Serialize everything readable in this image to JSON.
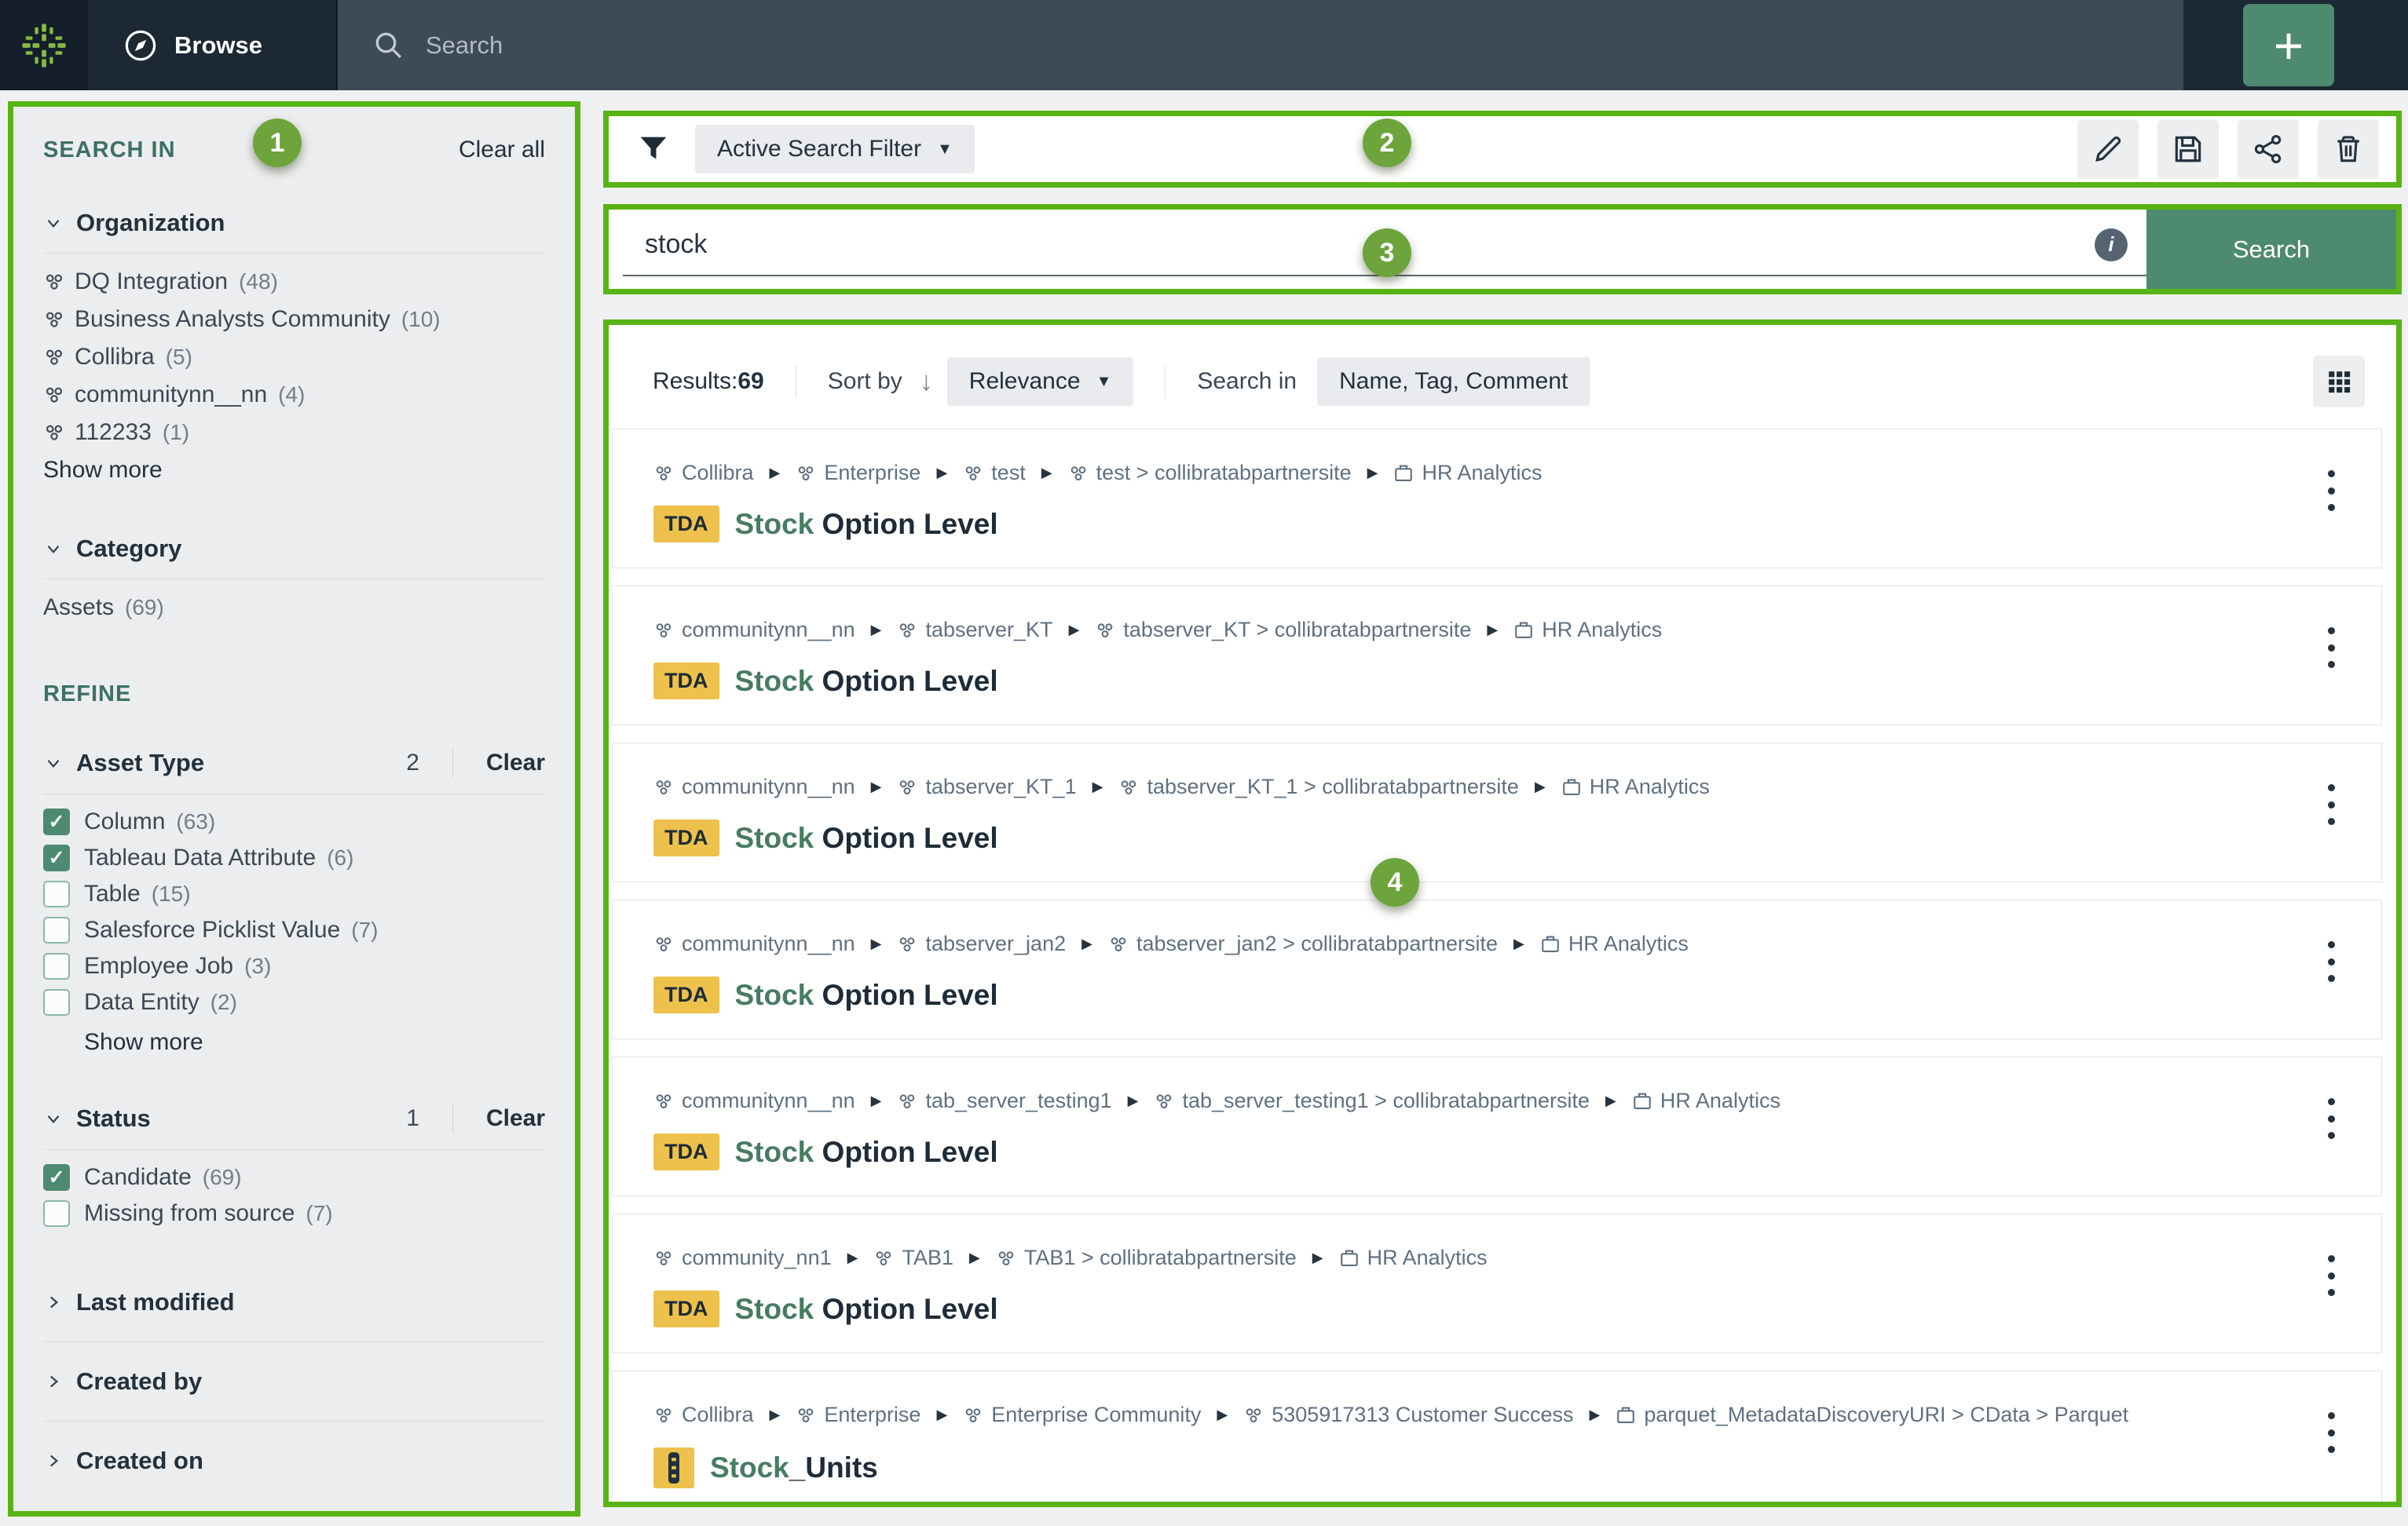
{
  "topbar": {
    "browse_label": "Browse",
    "search_placeholder": "Search",
    "plus_label": "+"
  },
  "annotations": {
    "border_color": "#58b314",
    "badge_color": "#6da43c",
    "badge1": "1",
    "badge2": "2",
    "badge3": "3",
    "badge4": "4"
  },
  "sidebar": {
    "search_in_label": "SEARCH IN",
    "clear_all_label": "Clear all",
    "organization": {
      "title": "Organization",
      "items": [
        {
          "label": "DQ Integration",
          "count": "(48)"
        },
        {
          "label": "Business Analysts Community",
          "count": "(10)"
        },
        {
          "label": "Collibra",
          "count": "(5)"
        },
        {
          "label": "communitynn__nn",
          "count": "(4)"
        },
        {
          "label": "112233",
          "count": "(1)"
        }
      ],
      "show_more": "Show more"
    },
    "category": {
      "title": "Category",
      "items": [
        {
          "label": "Assets",
          "count": "(69)"
        }
      ]
    },
    "refine_label": "REFINE",
    "asset_type": {
      "title": "Asset Type",
      "selected_count": "2",
      "clear_label": "Clear",
      "options": [
        {
          "label": "Column",
          "count": "(63)",
          "checked": true
        },
        {
          "label": "Tableau Data Attribute",
          "count": "(6)",
          "checked": true
        },
        {
          "label": "Table",
          "count": "(15)",
          "checked": false
        },
        {
          "label": "Salesforce Picklist Value",
          "count": "(7)",
          "checked": false
        },
        {
          "label": "Employee Job",
          "count": "(3)",
          "checked": false
        },
        {
          "label": "Data Entity",
          "count": "(2)",
          "checked": false
        }
      ],
      "show_more": "Show more"
    },
    "status": {
      "title": "Status",
      "selected_count": "1",
      "clear_label": "Clear",
      "options": [
        {
          "label": "Candidate",
          "count": "(69)",
          "checked": true
        },
        {
          "label": "Missing from source",
          "count": "(7)",
          "checked": false
        }
      ]
    },
    "collapsed": [
      {
        "title": "Last modified"
      },
      {
        "title": "Created by"
      },
      {
        "title": "Created on"
      }
    ]
  },
  "filterbar": {
    "active_filter_label": "Active Search Filter"
  },
  "searchbar": {
    "query": "stock",
    "button_label": "Search"
  },
  "results": {
    "results_label": "Results:",
    "count": "69",
    "sort_by_label": "Sort by",
    "sort_value": "Relevance",
    "search_in_label": "Search in",
    "search_fields": "Name, Tag, Comment",
    "items": [
      {
        "breadcrumbs": [
          {
            "icon": "community",
            "label": "Collibra"
          },
          {
            "icon": "community",
            "label": "Enterprise"
          },
          {
            "icon": "community",
            "label": "test"
          },
          {
            "icon": "community",
            "label": "test > collibratabpartnersite"
          },
          {
            "icon": "domain",
            "label": "HR Analytics"
          }
        ],
        "badge_type": "tda",
        "badge": "TDA",
        "title_highlight": "Stock",
        "title_rest": " Option Level"
      },
      {
        "breadcrumbs": [
          {
            "icon": "community",
            "label": "communitynn__nn"
          },
          {
            "icon": "community",
            "label": "tabserver_KT"
          },
          {
            "icon": "community",
            "label": "tabserver_KT > collibratabpartnersite"
          },
          {
            "icon": "domain",
            "label": "HR Analytics"
          }
        ],
        "badge_type": "tda",
        "badge": "TDA",
        "title_highlight": "Stock",
        "title_rest": " Option Level"
      },
      {
        "breadcrumbs": [
          {
            "icon": "community",
            "label": "communitynn__nn"
          },
          {
            "icon": "community",
            "label": "tabserver_KT_1"
          },
          {
            "icon": "community",
            "label": "tabserver_KT_1 > collibratabpartnersite"
          },
          {
            "icon": "domain",
            "label": "HR Analytics"
          }
        ],
        "badge_type": "tda",
        "badge": "TDA",
        "title_highlight": "Stock",
        "title_rest": " Option Level"
      },
      {
        "breadcrumbs": [
          {
            "icon": "community",
            "label": "communitynn__nn"
          },
          {
            "icon": "community",
            "label": "tabserver_jan2"
          },
          {
            "icon": "community",
            "label": "tabserver_jan2 > collibratabpartnersite"
          },
          {
            "icon": "domain",
            "label": "HR Analytics"
          }
        ],
        "badge_type": "tda",
        "badge": "TDA",
        "title_highlight": "Stock",
        "title_rest": " Option Level"
      },
      {
        "breadcrumbs": [
          {
            "icon": "community",
            "label": "communitynn__nn"
          },
          {
            "icon": "community",
            "label": "tab_server_testing1"
          },
          {
            "icon": "community",
            "label": "tab_server_testing1 > collibratabpartnersite"
          },
          {
            "icon": "domain",
            "label": "HR Analytics"
          }
        ],
        "badge_type": "tda",
        "badge": "TDA",
        "title_highlight": "Stock",
        "title_rest": " Option Level"
      },
      {
        "breadcrumbs": [
          {
            "icon": "community",
            "label": "community_nn1"
          },
          {
            "icon": "community",
            "label": "TAB1"
          },
          {
            "icon": "community",
            "label": "TAB1 > collibratabpartnersite"
          },
          {
            "icon": "domain",
            "label": "HR Analytics"
          }
        ],
        "badge_type": "tda",
        "badge": "TDA",
        "title_highlight": "Stock",
        "title_rest": " Option Level"
      },
      {
        "breadcrumbs": [
          {
            "icon": "community",
            "label": "Collibra"
          },
          {
            "icon": "community",
            "label": "Enterprise"
          },
          {
            "icon": "community",
            "label": "Enterprise Community"
          },
          {
            "icon": "community",
            "label": "5305917313 Customer Success"
          },
          {
            "icon": "domain",
            "label": "parquet_MetadataDiscoveryURI > CData > Parquet"
          }
        ],
        "badge_type": "column",
        "badge": "",
        "title_highlight": "Stock",
        "title_rest": "_Units"
      }
    ]
  }
}
